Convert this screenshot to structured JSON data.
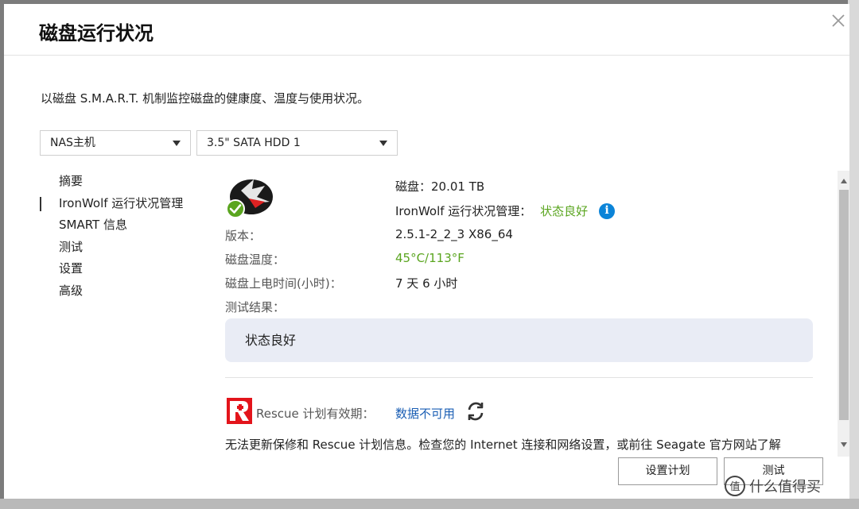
{
  "dialog": {
    "title": "磁盘运行状况",
    "description": "以磁盘 S.M.A.R.T. 机制监控磁盘的健康度、温度与使用状况。"
  },
  "selectors": {
    "host": "NAS主机",
    "disk": "3.5\" SATA HDD 1"
  },
  "nav": {
    "items": [
      {
        "label": "摘要"
      },
      {
        "label": "IronWolf 运行状况管理"
      },
      {
        "label": "SMART 信息"
      },
      {
        "label": "测试"
      },
      {
        "label": "设置"
      },
      {
        "label": "高级"
      }
    ],
    "active_index": 1
  },
  "details": {
    "disk_value": "磁盘：20.01 TB",
    "ironwolf_label": "IronWolf 运行状况管理：",
    "ironwolf_status": "状态良好",
    "version_label": "版本：",
    "version_value": "2.5.1-2_2_3 X86_64",
    "temp_label": "磁盘温度：",
    "temp_value": "45°C/113°F",
    "power_label": "磁盘上电时间(小时)：",
    "power_value": "7 天 6 小时",
    "result_label": "测试结果：",
    "result_value": "状态良好"
  },
  "rescue": {
    "label": "Rescue 计划有效期：",
    "link": "数据不可用",
    "note": "无法更新保修和 Rescue 计划信息。检查您的 Internet 连接和网络设置，或前往 Seagate 官方网站了解"
  },
  "buttons": {
    "schedule": "设置计划",
    "test": "测试"
  },
  "watermark": "值 什么值得买",
  "icons": {
    "close": "close-icon",
    "info": "info-icon",
    "refresh": "refresh-icon",
    "disk": "ironwolf-disk-icon",
    "rescue": "rescue-logo"
  },
  "colors": {
    "good": "#5aa51f",
    "link": "#1a5eb4",
    "info": "#0b84d8",
    "rescue_red": "#e3141b"
  }
}
